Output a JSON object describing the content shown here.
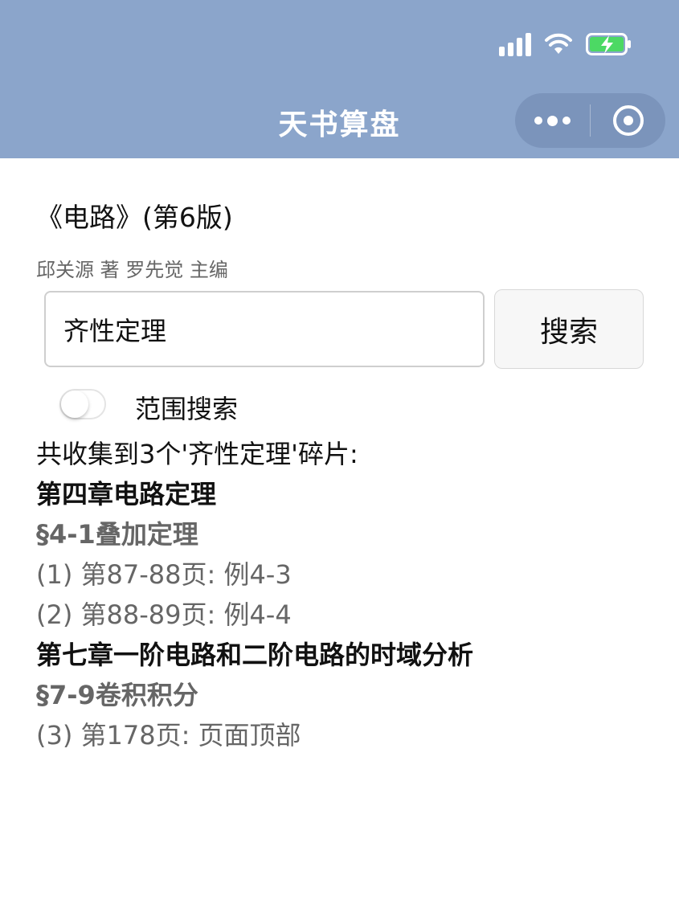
{
  "nav": {
    "title": "天书算盘",
    "more_icon": "more-dots-icon",
    "close_icon": "target-close-icon"
  },
  "status_bar": {
    "icons": [
      "signal-icon",
      "wifi-icon",
      "battery-charging-icon"
    ],
    "battery_color": "#4cd964"
  },
  "book": {
    "title": "《电路》(第6版)",
    "authors": "邱关源 著 罗先觉 主编"
  },
  "search": {
    "value": "齐性定理",
    "button_label": "搜索"
  },
  "range_toggle": {
    "label": "范围搜索",
    "enabled": false
  },
  "results": {
    "summary": "共收集到3个'齐性定理'碎片:",
    "groups": [
      {
        "chapter": "第四章电路定理",
        "section": "§4-1叠加定理",
        "entries": [
          "(1) 第87-88页: 例4-3",
          "(2) 第88-89页: 例4-4"
        ]
      },
      {
        "chapter": "第七章一阶电路和二阶电路的时域分析",
        "section": "§7-9卷积积分",
        "entries": [
          "(3) 第178页: 页面顶部"
        ]
      }
    ]
  },
  "colors": {
    "header_bg": "#8ba5cb",
    "secondary_text": "#666666"
  }
}
